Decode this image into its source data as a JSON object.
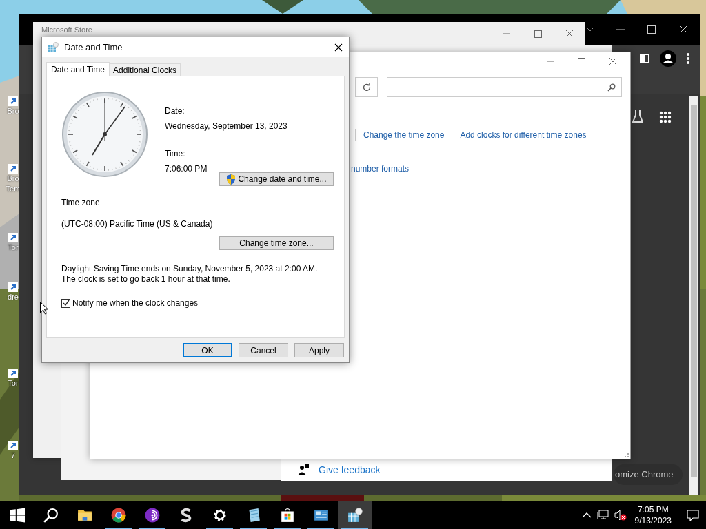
{
  "desktop": {
    "icons": [
      {
        "lines": [
          "Bro"
        ]
      },
      {
        "lines": [
          "Bro",
          "Tem"
        ]
      },
      {
        "lines": [
          "Tor"
        ]
      },
      {
        "lines": [
          "dre"
        ]
      },
      {
        "lines": [
          "Tor"
        ]
      },
      {
        "lines": [
          "7"
        ]
      }
    ]
  },
  "chrome": {
    "customize_label": "omize Chrome"
  },
  "store_window": {
    "title": "Microsoft Store"
  },
  "feedback_window": {
    "link": "Give feedback"
  },
  "control_panel": {
    "links": [
      "Change the time zone",
      "Add clocks for different time zones"
    ],
    "partial_link": "number formats"
  },
  "dialog": {
    "title": "Date and Time",
    "tabs": [
      {
        "label": "Date and Time",
        "selected": true
      },
      {
        "label": "Additional Clocks",
        "selected": false
      }
    ],
    "date_label": "Date:",
    "date": "Wednesday, September 13, 2023",
    "time_label": "Time:",
    "time": "7:06:00 PM",
    "change_datetime_button": "Change date and time...",
    "timezone_heading": "Time zone",
    "timezone": "(UTC-08:00) Pacific Time (US & Canada)",
    "change_timezone_button": "Change time zone...",
    "dst_note": "Daylight Saving Time ends on Sunday, November 5, 2023 at 2:00 AM. The clock is set to go back 1 hour at that time.",
    "notify": {
      "label": "Notify me when the clock changes",
      "checked": true
    },
    "buttons": [
      {
        "label": "OK",
        "default": true
      },
      {
        "label": "Cancel",
        "default": false
      },
      {
        "label": "Apply",
        "default": false
      }
    ]
  },
  "taskbar": {
    "apps": [
      {
        "kind": "start",
        "running": false,
        "selected": false
      },
      {
        "kind": "search",
        "running": false,
        "selected": false
      },
      {
        "kind": "folder",
        "running": false,
        "selected": false
      },
      {
        "kind": "chrome",
        "running": true,
        "selected": false
      },
      {
        "kind": "tor",
        "running": true,
        "selected": false
      },
      {
        "kind": "s",
        "running": false,
        "selected": false
      },
      {
        "kind": "gear",
        "running": true,
        "selected": false
      },
      {
        "kind": "notepad",
        "running": true,
        "selected": false
      },
      {
        "kind": "store",
        "running": true,
        "selected": false
      },
      {
        "kind": "panel",
        "running": true,
        "selected": false
      },
      {
        "kind": "calendar",
        "running": true,
        "selected": true
      }
    ],
    "time": "7:05 PM",
    "date": "9/13/2023"
  }
}
